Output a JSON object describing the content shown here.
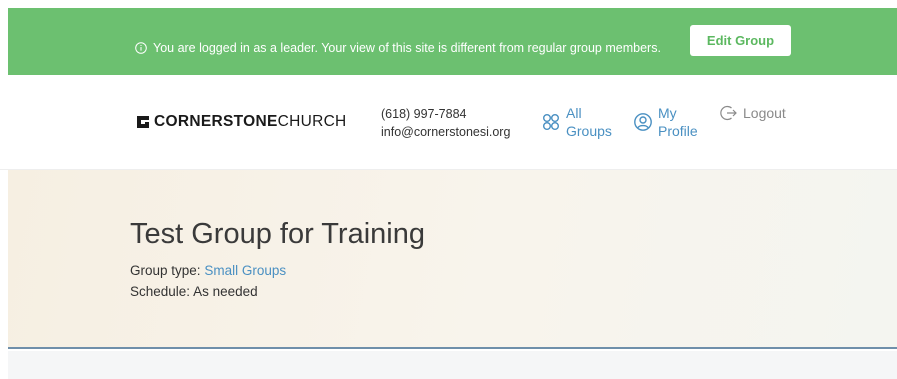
{
  "leader_banner": {
    "message": "You are logged in as a leader. Your view of this site is different from regular group members.",
    "edit_button": "Edit Group",
    "color": "#6cc070"
  },
  "header": {
    "logo_bold": "CORNERSTONE",
    "logo_light": "CHURCH",
    "phone": "(618) 997-7884",
    "email": "info@cornerstonesi.org",
    "nav": {
      "all_groups_line1": "All",
      "all_groups_line2": "Groups",
      "my_profile_line1": "My",
      "my_profile_line2": "Profile",
      "logout": "Logout"
    },
    "link_color": "#4a90c2"
  },
  "group": {
    "title": "Test Group for Training",
    "type_label": "Group type:",
    "type_value": "Small Groups",
    "schedule_label": "Schedule:",
    "schedule_value": "As needed"
  },
  "icons": [
    "info-icon",
    "logo-mark-icon",
    "groups-icon",
    "profile-icon",
    "logout-icon"
  ]
}
